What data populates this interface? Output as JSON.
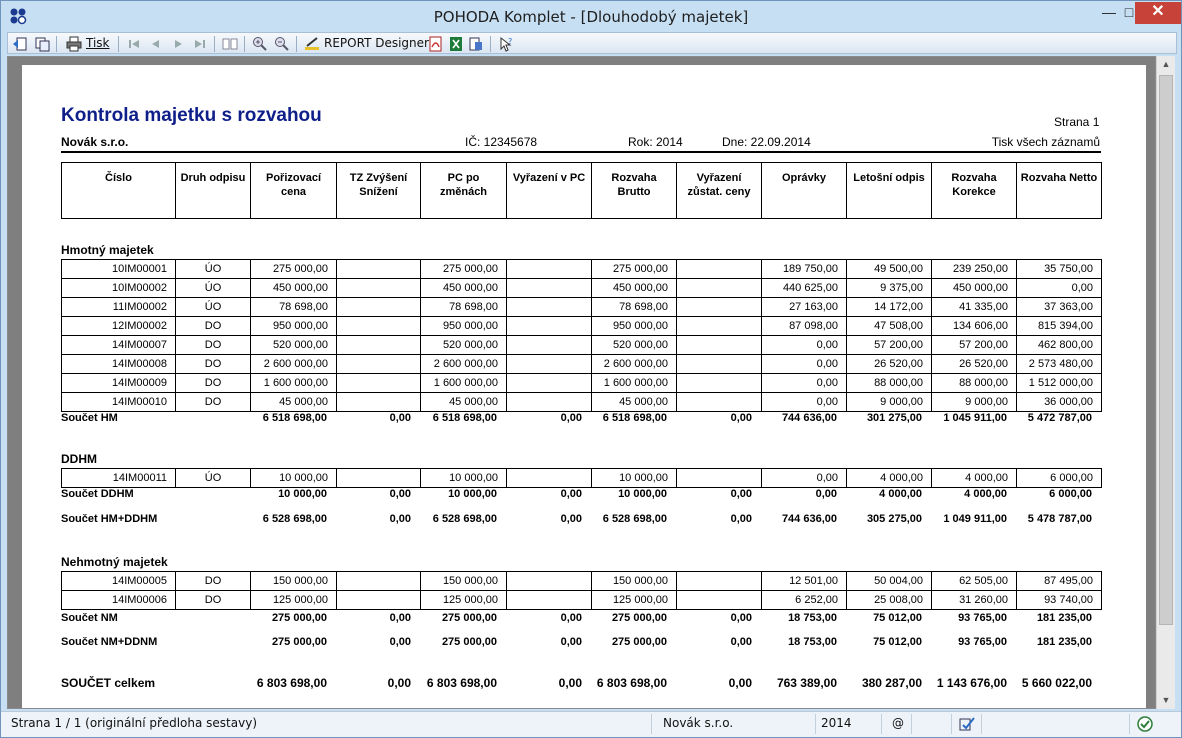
{
  "window": {
    "title": "POHODA Komplet - [Dlouhodobý majetek]"
  },
  "toolbar": {
    "print_label": "Tisk",
    "report_designer_label": "REPORT Designer"
  },
  "report": {
    "title": "Kontrola majetku s rozvahou",
    "company": "Novák s.r.o.",
    "ic": "IČ: 12345678",
    "year": "Rok: 2014",
    "date": "Dne: 22.09.2014",
    "page": "Strana 1",
    "mode": "Tisk všech záznamů",
    "columns": [
      "Číslo",
      "Druh odpisu",
      "Pořizovací cena",
      "TZ Zvýšení Snížení",
      "PC po změnách",
      "Vyřazení v PC",
      "Rozvaha Brutto",
      "Vyřazení zůstat. ceny",
      "Oprávky",
      "Letošní odpis",
      "Rozvaha Korekce",
      "Rozvaha Netto"
    ],
    "sections": [
      {
        "name": "Hmotný majetek",
        "rows": [
          [
            "10IM00001",
            "ÚO",
            "275 000,00",
            "",
            "275 000,00",
            "",
            "275 000,00",
            "",
            "189 750,00",
            "49 500,00",
            "239 250,00",
            "35 750,00"
          ],
          [
            "10IM00002",
            "ÚO",
            "450 000,00",
            "",
            "450 000,00",
            "",
            "450 000,00",
            "",
            "440 625,00",
            "9 375,00",
            "450 000,00",
            "0,00"
          ],
          [
            "11IM00002",
            "ÚO",
            "78 698,00",
            "",
            "78 698,00",
            "",
            "78 698,00",
            "",
            "27 163,00",
            "14 172,00",
            "41 335,00",
            "37 363,00"
          ],
          [
            "12IM00002",
            "DO",
            "950 000,00",
            "",
            "950 000,00",
            "",
            "950 000,00",
            "",
            "87 098,00",
            "47 508,00",
            "134 606,00",
            "815 394,00"
          ],
          [
            "14IM00007",
            "DO",
            "520 000,00",
            "",
            "520 000,00",
            "",
            "520 000,00",
            "",
            "0,00",
            "57 200,00",
            "57 200,00",
            "462 800,00"
          ],
          [
            "14IM00008",
            "DO",
            "2 600 000,00",
            "",
            "2 600 000,00",
            "",
            "2 600 000,00",
            "",
            "0,00",
            "26 520,00",
            "26 520,00",
            "2 573 480,00"
          ],
          [
            "14IM00009",
            "DO",
            "1 600 000,00",
            "",
            "1 600 000,00",
            "",
            "1 600 000,00",
            "",
            "0,00",
            "88 000,00",
            "88 000,00",
            "1 512 000,00"
          ],
          [
            "14IM00010",
            "DO",
            "45 000,00",
            "",
            "45 000,00",
            "",
            "45 000,00",
            "",
            "0,00",
            "9 000,00",
            "9 000,00",
            "36 000,00"
          ]
        ],
        "sum": [
          "Součet HM",
          "6 518 698,00",
          "0,00",
          "6 518 698,00",
          "0,00",
          "6 518 698,00",
          "0,00",
          "744 636,00",
          "301 275,00",
          "1 045 911,00",
          "5 472 787,00"
        ]
      },
      {
        "name": "DDHM",
        "rows": [
          [
            "14IM00011",
            "ÚO",
            "10 000,00",
            "",
            "10 000,00",
            "",
            "10 000,00",
            "",
            "0,00",
            "4 000,00",
            "4 000,00",
            "6 000,00"
          ]
        ],
        "sum": [
          "Součet DDHM",
          "10 000,00",
          "0,00",
          "10 000,00",
          "0,00",
          "10 000,00",
          "0,00",
          "0,00",
          "4 000,00",
          "4 000,00",
          "6 000,00"
        ],
        "sum2": [
          "Součet HM+DDHM",
          "6 528 698,00",
          "0,00",
          "6 528 698,00",
          "0,00",
          "6 528 698,00",
          "0,00",
          "744 636,00",
          "305 275,00",
          "1 049 911,00",
          "5 478 787,00"
        ]
      },
      {
        "name": "Nehmotný majetek",
        "rows": [
          [
            "14IM00005",
            "DO",
            "150 000,00",
            "",
            "150 000,00",
            "",
            "150 000,00",
            "",
            "12 501,00",
            "50 004,00",
            "62 505,00",
            "87 495,00"
          ],
          [
            "14IM00006",
            "DO",
            "125 000,00",
            "",
            "125 000,00",
            "",
            "125 000,00",
            "",
            "6 252,00",
            "25 008,00",
            "31 260,00",
            "93 740,00"
          ]
        ],
        "sum": [
          "Součet NM",
          "275 000,00",
          "0,00",
          "275 000,00",
          "0,00",
          "275 000,00",
          "0,00",
          "18 753,00",
          "75 012,00",
          "93 765,00",
          "181 235,00"
        ],
        "sum2": [
          "Součet NM+DDNM",
          "275 000,00",
          "0,00",
          "275 000,00",
          "0,00",
          "275 000,00",
          "0,00",
          "18 753,00",
          "75 012,00",
          "93 765,00",
          "181 235,00"
        ]
      }
    ],
    "grand_total": [
      "SOUČET celkem",
      "6 803 698,00",
      "0,00",
      "6 803 698,00",
      "0,00",
      "6 803 698,00",
      "0,00",
      "763 389,00",
      "380 287,00",
      "1 143 676,00",
      "5 660 022,00"
    ]
  },
  "statusbar": {
    "page_info": "Strana 1 / 1  (originální předloha sestavy)",
    "company": "Novák s.r.o.",
    "year": "2014",
    "at": "@"
  },
  "icons": [
    "app-icon",
    "back-icon",
    "copy-icon",
    "print-icon",
    "first-page-icon",
    "prev-page-icon",
    "next-page-icon",
    "last-page-icon",
    "two-pages-icon",
    "zoom-in-icon",
    "zoom-out-icon",
    "report-designer-icon",
    "pdf-icon",
    "excel-icon",
    "export-icon",
    "help-icon",
    "check-icon",
    "ok-icon"
  ]
}
